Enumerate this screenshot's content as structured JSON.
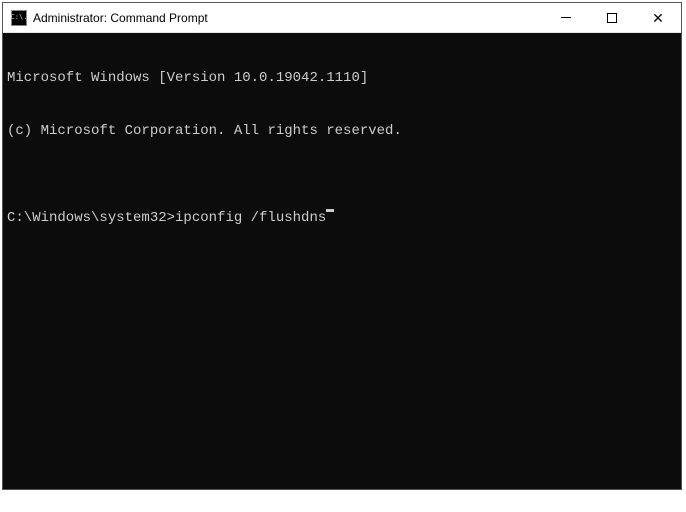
{
  "window": {
    "title": "Administrator: Command Prompt",
    "icon_label": "C:\\."
  },
  "terminal": {
    "line1": "Microsoft Windows [Version 10.0.19042.1110]",
    "line2": "(c) Microsoft Corporation. All rights reserved.",
    "blank1": "",
    "prompt": "C:\\Windows\\system32>",
    "command": "ipconfig /flushdns"
  }
}
